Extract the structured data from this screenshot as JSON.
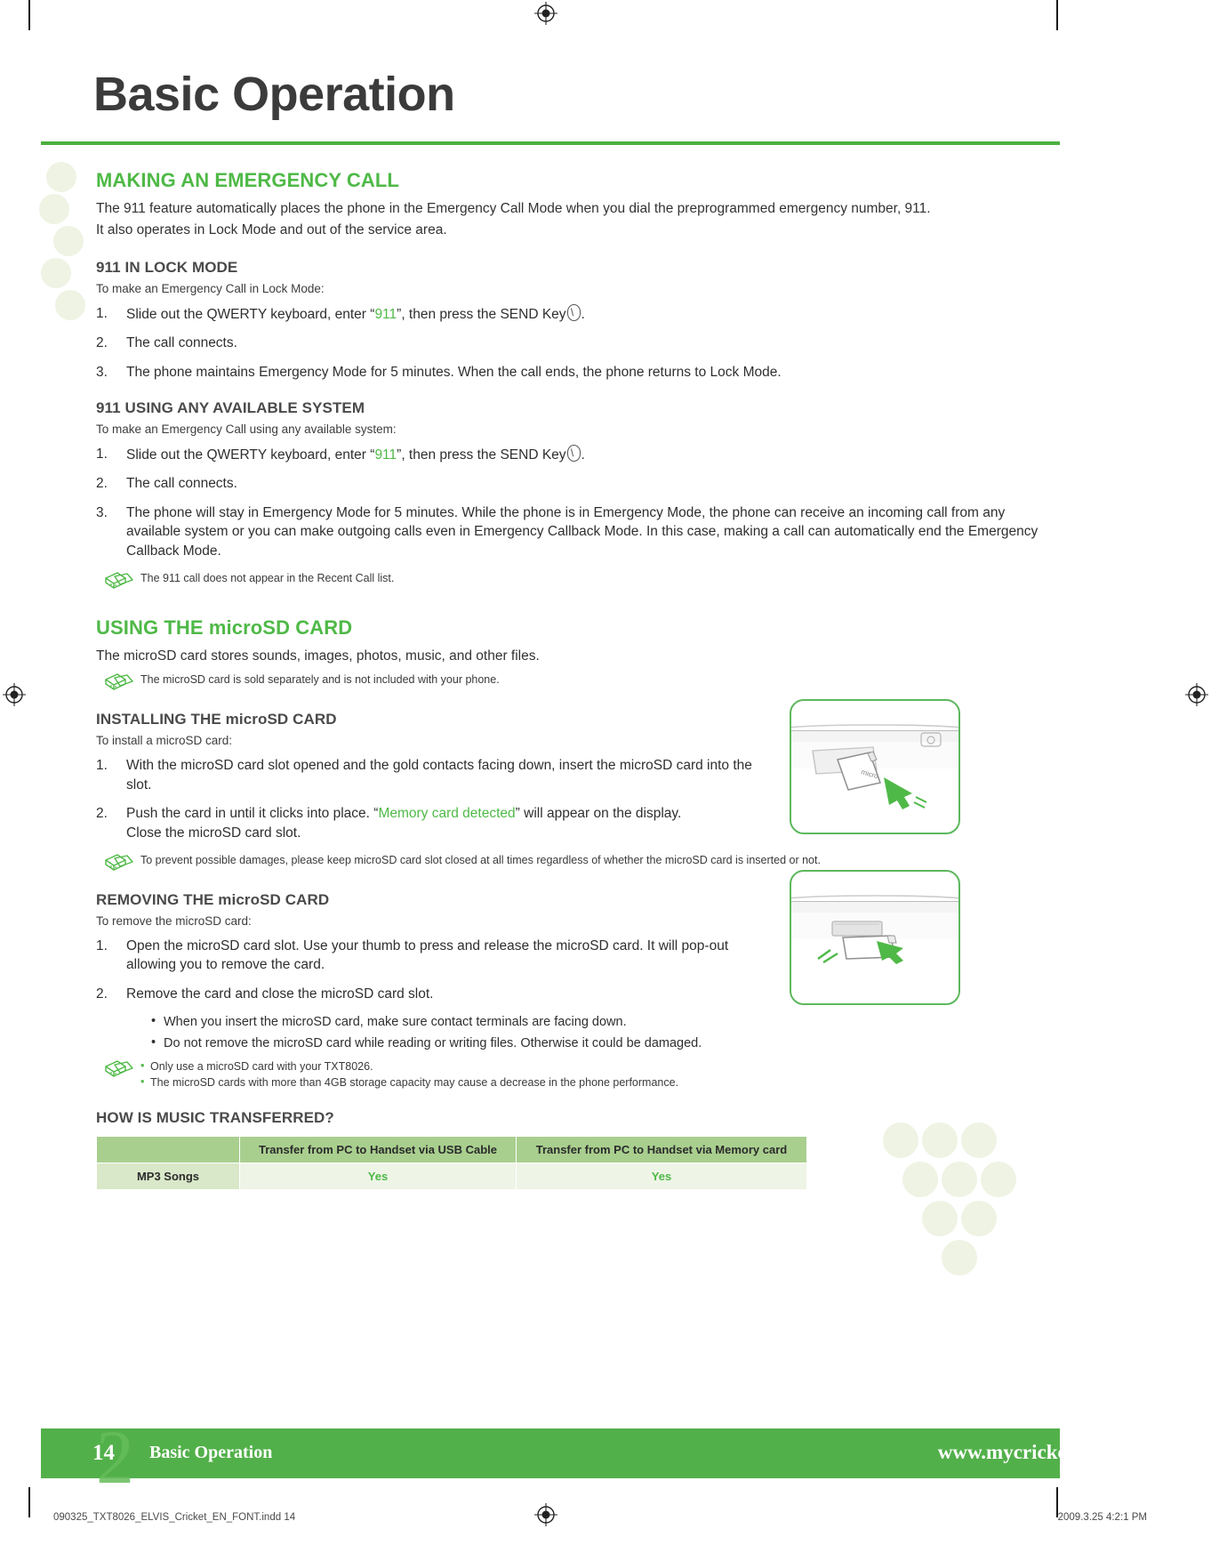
{
  "page": {
    "title": "Basic Operation",
    "number": "14",
    "footer_section": "Basic Operation",
    "footer_url": "www.mycricket.com",
    "slug_left": "090325_TXT8026_ELVIS_Cricket_EN_FONT.indd   14",
    "slug_right": "2009.3.25   4:2:1 PM"
  },
  "colors": {
    "brand_green": "#4fb947",
    "rule_green": "#4caf3e",
    "footer_green": "#52b04a",
    "heading_gray": "#4a4a4a",
    "table_header": "#a9cf8f",
    "table_rowhead": "#d9e8c9",
    "table_cell": "#eef4e6"
  },
  "sections": {
    "emergency": {
      "heading": "MAKING AN EMERGENCY CALL",
      "intro_line1": "The 911 feature automatically places the phone in the Emergency Call Mode when you dial the preprogrammed emergency number, 911.",
      "intro_line2": "It also operates in Lock Mode and out of the service area.",
      "lock_mode": {
        "heading": "911 IN LOCK MODE",
        "lead": "To make an Emergency Call in Lock Mode:",
        "steps": [
          {
            "num": "1.",
            "pre": "Slide out the QWERTY keyboard, enter “",
            "highlight": "911",
            "post": "”, then press the SEND Key",
            "tail": ".",
            "has_key_icon": true
          },
          {
            "num": "2.",
            "pre": "The call connects.",
            "highlight": "",
            "post": "",
            "tail": "",
            "has_key_icon": false
          },
          {
            "num": "3.",
            "pre": "The phone maintains Emergency Mode for 5 minutes. When the call ends, the phone returns to Lock Mode.",
            "highlight": "",
            "post": "",
            "tail": "",
            "has_key_icon": false
          }
        ]
      },
      "any_system": {
        "heading": "911 USING ANY AVAILABLE SYSTEM",
        "lead": "To make an Emergency Call using any available system:",
        "steps": [
          {
            "num": "1.",
            "pre": "Slide out the QWERTY keyboard, enter “",
            "highlight": "911",
            "post": "”, then press the SEND Key",
            "tail": ".",
            "has_key_icon": true
          },
          {
            "num": "2.",
            "pre": "The call connects.",
            "highlight": "",
            "post": "",
            "tail": "",
            "has_key_icon": false
          },
          {
            "num": "3.",
            "pre": "The phone will stay in Emergency Mode for 5 minutes. While the phone is in Emergency Mode, the phone can receive an incoming call from any available system or you can make outgoing calls even in Emergency Callback Mode. In this case, making a call can automatically end the Emergency Callback Mode.",
            "highlight": "",
            "post": "",
            "tail": "",
            "has_key_icon": false
          }
        ],
        "note": "The 911 call does not appear in the Recent Call list."
      }
    },
    "microsd": {
      "heading": "USING THE microSD CARD",
      "intro": "The microSD card stores sounds, images, photos, music, and other files.",
      "note": "The microSD card is sold separately and is not included with your phone.",
      "installing": {
        "heading": "INSTALLING THE microSD CARD",
        "lead": "To install a microSD card:",
        "steps": [
          {
            "num": "1.",
            "pre": "With the microSD card slot opened and the gold contacts facing down, insert the microSD card into the slot.",
            "highlight": "",
            "post": "",
            "tail": "",
            "has_key_icon": false
          },
          {
            "num": "2.",
            "pre": "Push the card in until it clicks into place. “",
            "highlight": "Memory card detected",
            "post": "” will appear on the display.",
            "tail": "",
            "second_line": "Close the microSD card slot.",
            "has_key_icon": false
          }
        ],
        "note": "To prevent possible damages, please keep microSD card slot closed at all times regardless of whether the microSD card is inserted or not."
      },
      "removing": {
        "heading": "REMOVING THE microSD CARD",
        "lead": "To remove the microSD card:",
        "steps": [
          {
            "num": "1.",
            "pre": "Open the microSD card slot. Use your thumb to press and release the microSD card. It will pop-out allowing you to remove the card.",
            "highlight": "",
            "post": "",
            "tail": "",
            "has_key_icon": false
          },
          {
            "num": "2.",
            "pre": "Remove the card and close the microSD card slot.",
            "highlight": "",
            "post": "",
            "tail": "",
            "has_key_icon": false
          }
        ],
        "bullets": [
          "When you insert the microSD card, make sure contact terminals are facing down.",
          "Do not remove the microSD card while reading or writing files. Otherwise it could be damaged."
        ],
        "note_items": [
          "Only use a microSD card with your TXT8026.",
          "The microSD cards with more than 4GB storage capacity may cause a decrease in the phone performance."
        ]
      },
      "music": {
        "heading": "HOW IS MUSIC TRANSFERRED?",
        "table": {
          "columns": [
            "",
            "Transfer from PC to Handset via USB Cable",
            "Transfer from PC to Handset via Memory card"
          ],
          "rows": [
            {
              "label": "MP3 Songs",
              "values": [
                "Yes",
                "Yes"
              ]
            }
          ]
        }
      }
    }
  },
  "illustrations": {
    "install_label": "microsd-card-insert-diagram",
    "remove_label": "microsd-card-remove-diagram"
  }
}
